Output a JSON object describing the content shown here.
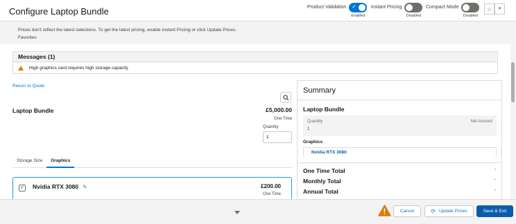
{
  "header": {
    "title": "Configure Laptop Bundle",
    "toggles": [
      {
        "label": "Product Validation",
        "state": "Enabled",
        "on": true
      },
      {
        "label": "Instant Pricing",
        "state": "Disabled",
        "on": false
      },
      {
        "label": "Compact Mode",
        "state": "Disabled",
        "on": false
      }
    ],
    "star_icon": "star-icon",
    "dropdown_icon": "chevron-down-icon"
  },
  "info": {
    "message": "Prices don't reflect the latest selections. To get the latest pricing, enable Instant Pricing or click Update Prices.",
    "favorites": "Favorites"
  },
  "messages": {
    "title": "Messages (1)",
    "items": [
      {
        "icon": "warning-icon",
        "text": "High graphics card requires high storage capacity"
      }
    ]
  },
  "main": {
    "return_link": "Return to Quote",
    "bundle_name": "Laptop Bundle",
    "price": "£5,000.00",
    "price_frequency": "One Time",
    "quantity_label": "Quantity",
    "quantity_value": "1",
    "tabs": [
      {
        "label": "Storage Size",
        "active": false
      },
      {
        "label": "Graphics",
        "active": true
      }
    ],
    "option": {
      "name": "Nvidia RTX 3080",
      "checked": true,
      "price": "£200.00",
      "frequency": "One Time"
    }
  },
  "summary": {
    "title": "Summary",
    "bundle_name": "Laptop Bundle",
    "quantity_label": "Quantity",
    "quantity_value": "1",
    "net_amount_label": "Net Amount",
    "group_label": "Graphics",
    "group_item": "Nvidia RTX 3080",
    "totals": [
      {
        "label": "One Time Total",
        "value": "-"
      },
      {
        "label": "Monthly Total",
        "value": "-"
      },
      {
        "label": "Annual Total",
        "value": "-"
      }
    ]
  },
  "footer": {
    "cancel_label": "Cancel",
    "update_prices_label": "Update Prices",
    "save_exit_label": "Save & Exit"
  },
  "colors": {
    "brand": "#0176d3",
    "brand_dark": "#0b5cab",
    "warning": "#dd7a01",
    "selected_border": "#1b96ff"
  }
}
